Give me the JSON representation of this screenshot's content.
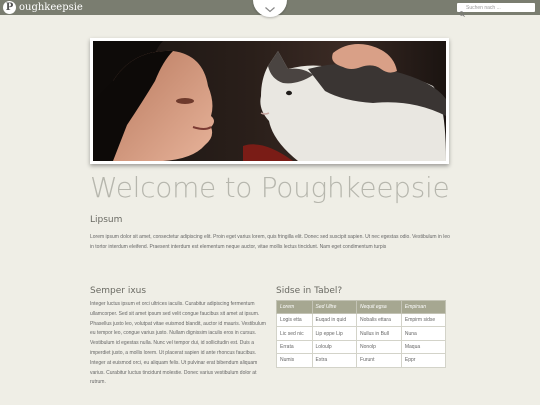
{
  "header": {
    "logo_letter": "P",
    "site_name": "oughkeepsie",
    "search_placeholder": "Suchen nach ..."
  },
  "page": {
    "title": "Welcome to Poughkeepsie"
  },
  "lipsum": {
    "heading": "Lipsum",
    "text": "Lorem ipsum dolor sit amet, consectetur adipiscing elit. Proin eget varius lorem, quis fringilla elit. Donec sed suscipit sapien. Ut nec egestas odio. Vestibulum in leo in tortor interdum eleifend. Praesent interdum est elementum neque auctor, vitae mollis lectus tincidunt. Nam eget condimentum turpis"
  },
  "semper": {
    "heading": "Semper ixus",
    "text": "Integer luctus ipsum et orci ultrices iaculis. Curabitur adipiscing fermentum ullamcorper. Sed sit amet ipsum sed velit congue faucibus sit amet at ipsum. Phasellus justo leo, volutpat vitae euismod blandit, auctor id mauris. Vestibulum eu tempor leo, congue varius justo. Nullam dignissim iaculis eros in cursus. Vestibulum id egestas nulla. Nunc vel tempor dui, id sollicitudin est. Duis a imperdiet justo, a mollis lorem. Ut placerat sapien id ante rhoncus faucibus. Integer at euismod orci, eu aliquam felis. Ut pulvinar erat bibendum aliquam varius. Curabitur luctus tincidunt molestie. Donec varius vestibulum dolor at rutrum."
  },
  "table": {
    "heading": "Sidse in Tabel?",
    "columns": [
      "Lorem",
      "Sed Ultre",
      "Nequit egsa",
      "Empirsan"
    ],
    "rows": [
      [
        "Logis etta",
        "Euqad in quid",
        "Nobalis ettara",
        "Empirm sidse"
      ],
      [
        "Lic sed nic",
        "Lip eppe Lip",
        "Nullus in Bull",
        "Nuna"
      ],
      [
        "Errata",
        "Loloulp",
        "Nonolp",
        "Maqua"
      ],
      [
        "Numis",
        "Extra",
        "Furunt",
        "Eppr"
      ]
    ]
  },
  "colors": {
    "topbar": "#7a7d70",
    "background": "#efeee6",
    "table_header": "#a6a791",
    "title": "#b6b6ad"
  },
  "icons": {
    "menu_toggle": "chevron-down-icon",
    "search": "search-icon",
    "hero": "woman-with-cat-photo"
  }
}
